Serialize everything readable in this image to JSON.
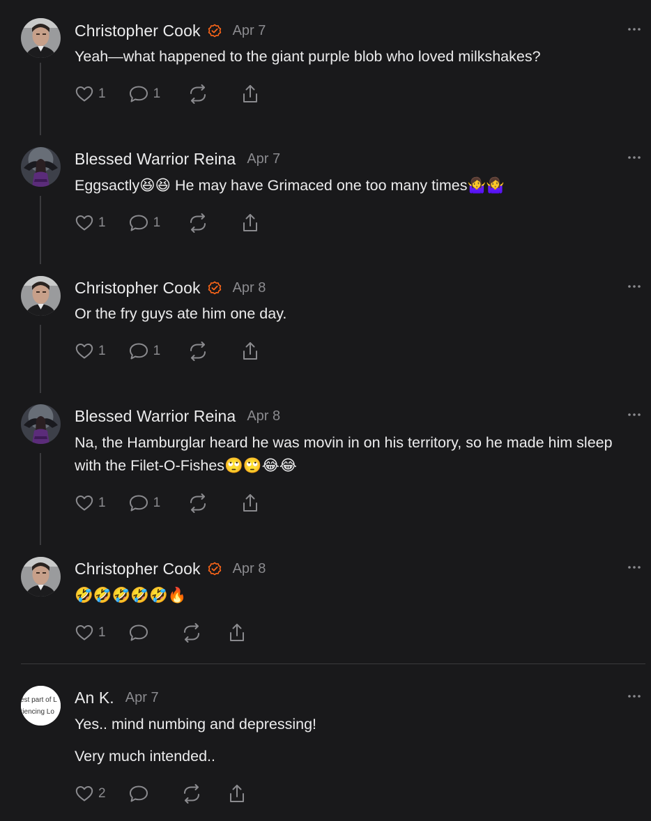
{
  "colors": {
    "background": "#19191b",
    "text": "#ececed",
    "muted": "#8b8b8f",
    "verified": "#ff6719",
    "thread_line": "#3a3a3d"
  },
  "icons": {
    "like": "heart-icon",
    "reply": "speech-bubble-icon",
    "restack": "restack-icon",
    "share": "share-icon",
    "more": "more-dots-icon",
    "verified": "verified-check-icon"
  },
  "comments": [
    {
      "author": "Christopher Cook",
      "verified": true,
      "date": "Apr 7",
      "body": [
        "Yeah—what happened to the giant purple blob who loved milkshakes?"
      ],
      "likes": "1",
      "replies": "1"
    },
    {
      "author": "Blessed Warrior Reina",
      "verified": false,
      "date": "Apr 7",
      "body": [
        "Eggsactly😆😆 He may have Grimaced one too many times🤷‍♀️🤷‍♀️"
      ],
      "likes": "1",
      "replies": "1"
    },
    {
      "author": "Christopher Cook",
      "verified": true,
      "date": "Apr 8",
      "body": [
        "Or the fry guys ate him one day."
      ],
      "likes": "1",
      "replies": "1"
    },
    {
      "author": "Blessed Warrior Reina",
      "verified": false,
      "date": "Apr 8",
      "body": [
        "Na, the Hamburglar heard he was movin in on his territory, so he made him sleep with the Filet-O-Fishes🙄🙄😂😂"
      ],
      "likes": "1",
      "replies": "1"
    },
    {
      "author": "Christopher Cook",
      "verified": true,
      "date": "Apr 8",
      "body": [
        "🤣🤣🤣🤣🤣🔥"
      ],
      "likes": "1",
      "replies": ""
    },
    {
      "author": "An K.",
      "verified": false,
      "date": "Apr 7",
      "avatar_text": [
        "est part of L",
        "riencing Lo"
      ],
      "body": [
        "Yes.. mind numbing and depressing!",
        "Very much intended.."
      ],
      "likes": "2",
      "replies": ""
    }
  ]
}
